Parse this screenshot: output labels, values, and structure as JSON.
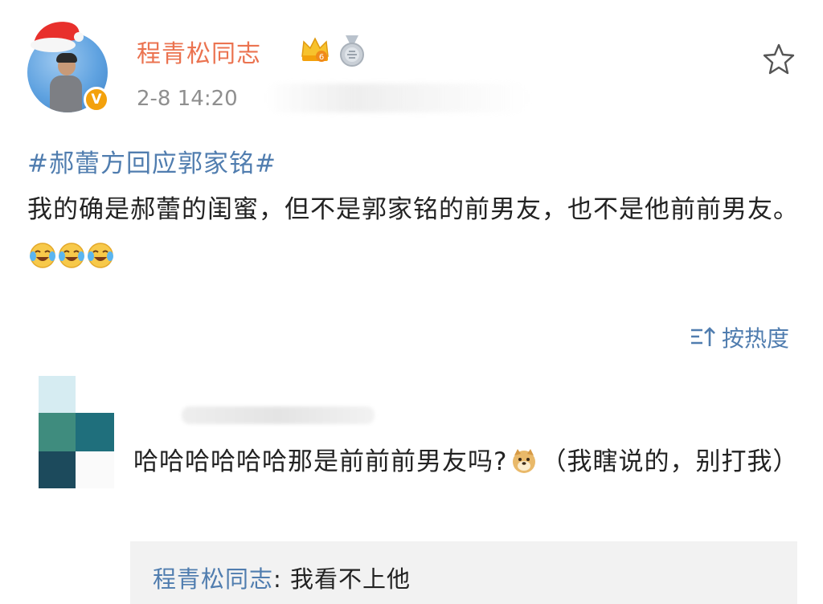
{
  "post": {
    "author": "程青松同志",
    "time": "2-8 14:20",
    "topic": "#郝蕾方回应郭家铭#",
    "text": "我的确是郝蕾的闺蜜，但不是郭家铭的前男友，也不是他前前男友。",
    "verified_badge": "V",
    "emojis": [
      "laugh-cry-emoji",
      "laugh-cry-emoji",
      "laugh-cry-emoji"
    ],
    "icons": [
      "santa-hat-icon",
      "crown-icon",
      "medal-icon",
      "star-icon"
    ]
  },
  "sort": {
    "label": "按热度",
    "icon": "sort-icon"
  },
  "comment": {
    "text_before_emoji": "哈哈哈哈哈哈那是前前前男友吗?",
    "emoji": "doge-emoji",
    "text_after_emoji": "（我瞎说的，别打我）",
    "reply": {
      "author": "程青松同志",
      "separator": ": ",
      "text": "我看不上他"
    }
  },
  "colors": {
    "username": "#eb7350",
    "link": "#507daf",
    "time": "#8f8f8f",
    "badge": "#f3a10c",
    "reply_bg": "#f2f2f2"
  }
}
